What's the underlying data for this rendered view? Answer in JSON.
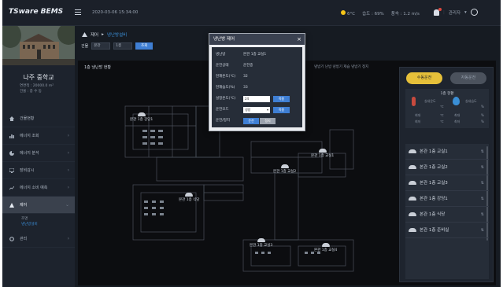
{
  "app": {
    "brand": "TSware BEMS"
  },
  "header": {
    "datetime": "2020-03-06 15:34:00",
    "weather": {
      "temp": "6°C",
      "humidity": "습도 : 69%",
      "wind": "풍속 : 1.2 m/s"
    },
    "user": "관리자"
  },
  "sidebar": {
    "school_name": "나주 중학교",
    "info_area": "연면적 : 20000.0 m²",
    "info_floors": "건물 : 층 수 동",
    "nav": [
      {
        "label": "건물현황"
      },
      {
        "label": "에너지 조회"
      },
      {
        "label": "에너지 분석"
      },
      {
        "label": "장비감시"
      },
      {
        "label": "에너지 소비 예측"
      },
      {
        "label": "제어"
      },
      {
        "label": "관리"
      }
    ],
    "sub_items": [
      "조명",
      "냉난방설비"
    ]
  },
  "main": {
    "breadcrumb": {
      "root": "제어",
      "current": "냉난방설비"
    },
    "filter": {
      "label": "건물",
      "select1": "본관",
      "select2": "1층",
      "search": "조회"
    },
    "floor_title": "1층 냉난방 현황",
    "legend": "냉방기 난방  냉방기 제습  냉방기 정지",
    "rooms": [
      {
        "label": "본관 1층 강당1"
      },
      {
        "label": "본관 1층 교실1"
      },
      {
        "label": "본관 1층 교실2"
      },
      {
        "label": "본관 1층 식당"
      },
      {
        "label": "본관 1층 교실3"
      },
      {
        "label": "본관 1층 교실4"
      }
    ]
  },
  "panel": {
    "manual_btn": "수동운전",
    "auto_btn": "자동운전",
    "status_title": "1층 현황",
    "indoor_temp": "실내온도",
    "indoor_humid": "실내습도",
    "temp_unit": "℃",
    "humid_unit": "%",
    "max_label": "최대",
    "min_label": "최저",
    "units": [
      {
        "label": "본관 1층 교실1"
      },
      {
        "label": "본관 1층 교실2"
      },
      {
        "label": "본관 1층 교실3"
      },
      {
        "label": "본관 1층 강당1"
      },
      {
        "label": "본관 1층 식당"
      },
      {
        "label": "본관 1층 준비실"
      }
    ]
  },
  "modal": {
    "title": "냉난방 제어",
    "rows": {
      "name_label": "냉난방",
      "name_value": "본관 1층 교실1",
      "state_label": "운전상태",
      "state_value": "운전중",
      "cur_temp_label": "현재온도(℃)",
      "cur_temp_value": "32",
      "cur_humid_label": "현재습도(%)",
      "cur_humid_value": "33",
      "set_temp_label": "설정온도(℃)",
      "set_temp_value": "24",
      "mode_label": "운전모드",
      "mode_value": "냉방",
      "power_label": "운전/정지",
      "apply": "적용",
      "on": "운전",
      "off": "정지"
    }
  }
}
